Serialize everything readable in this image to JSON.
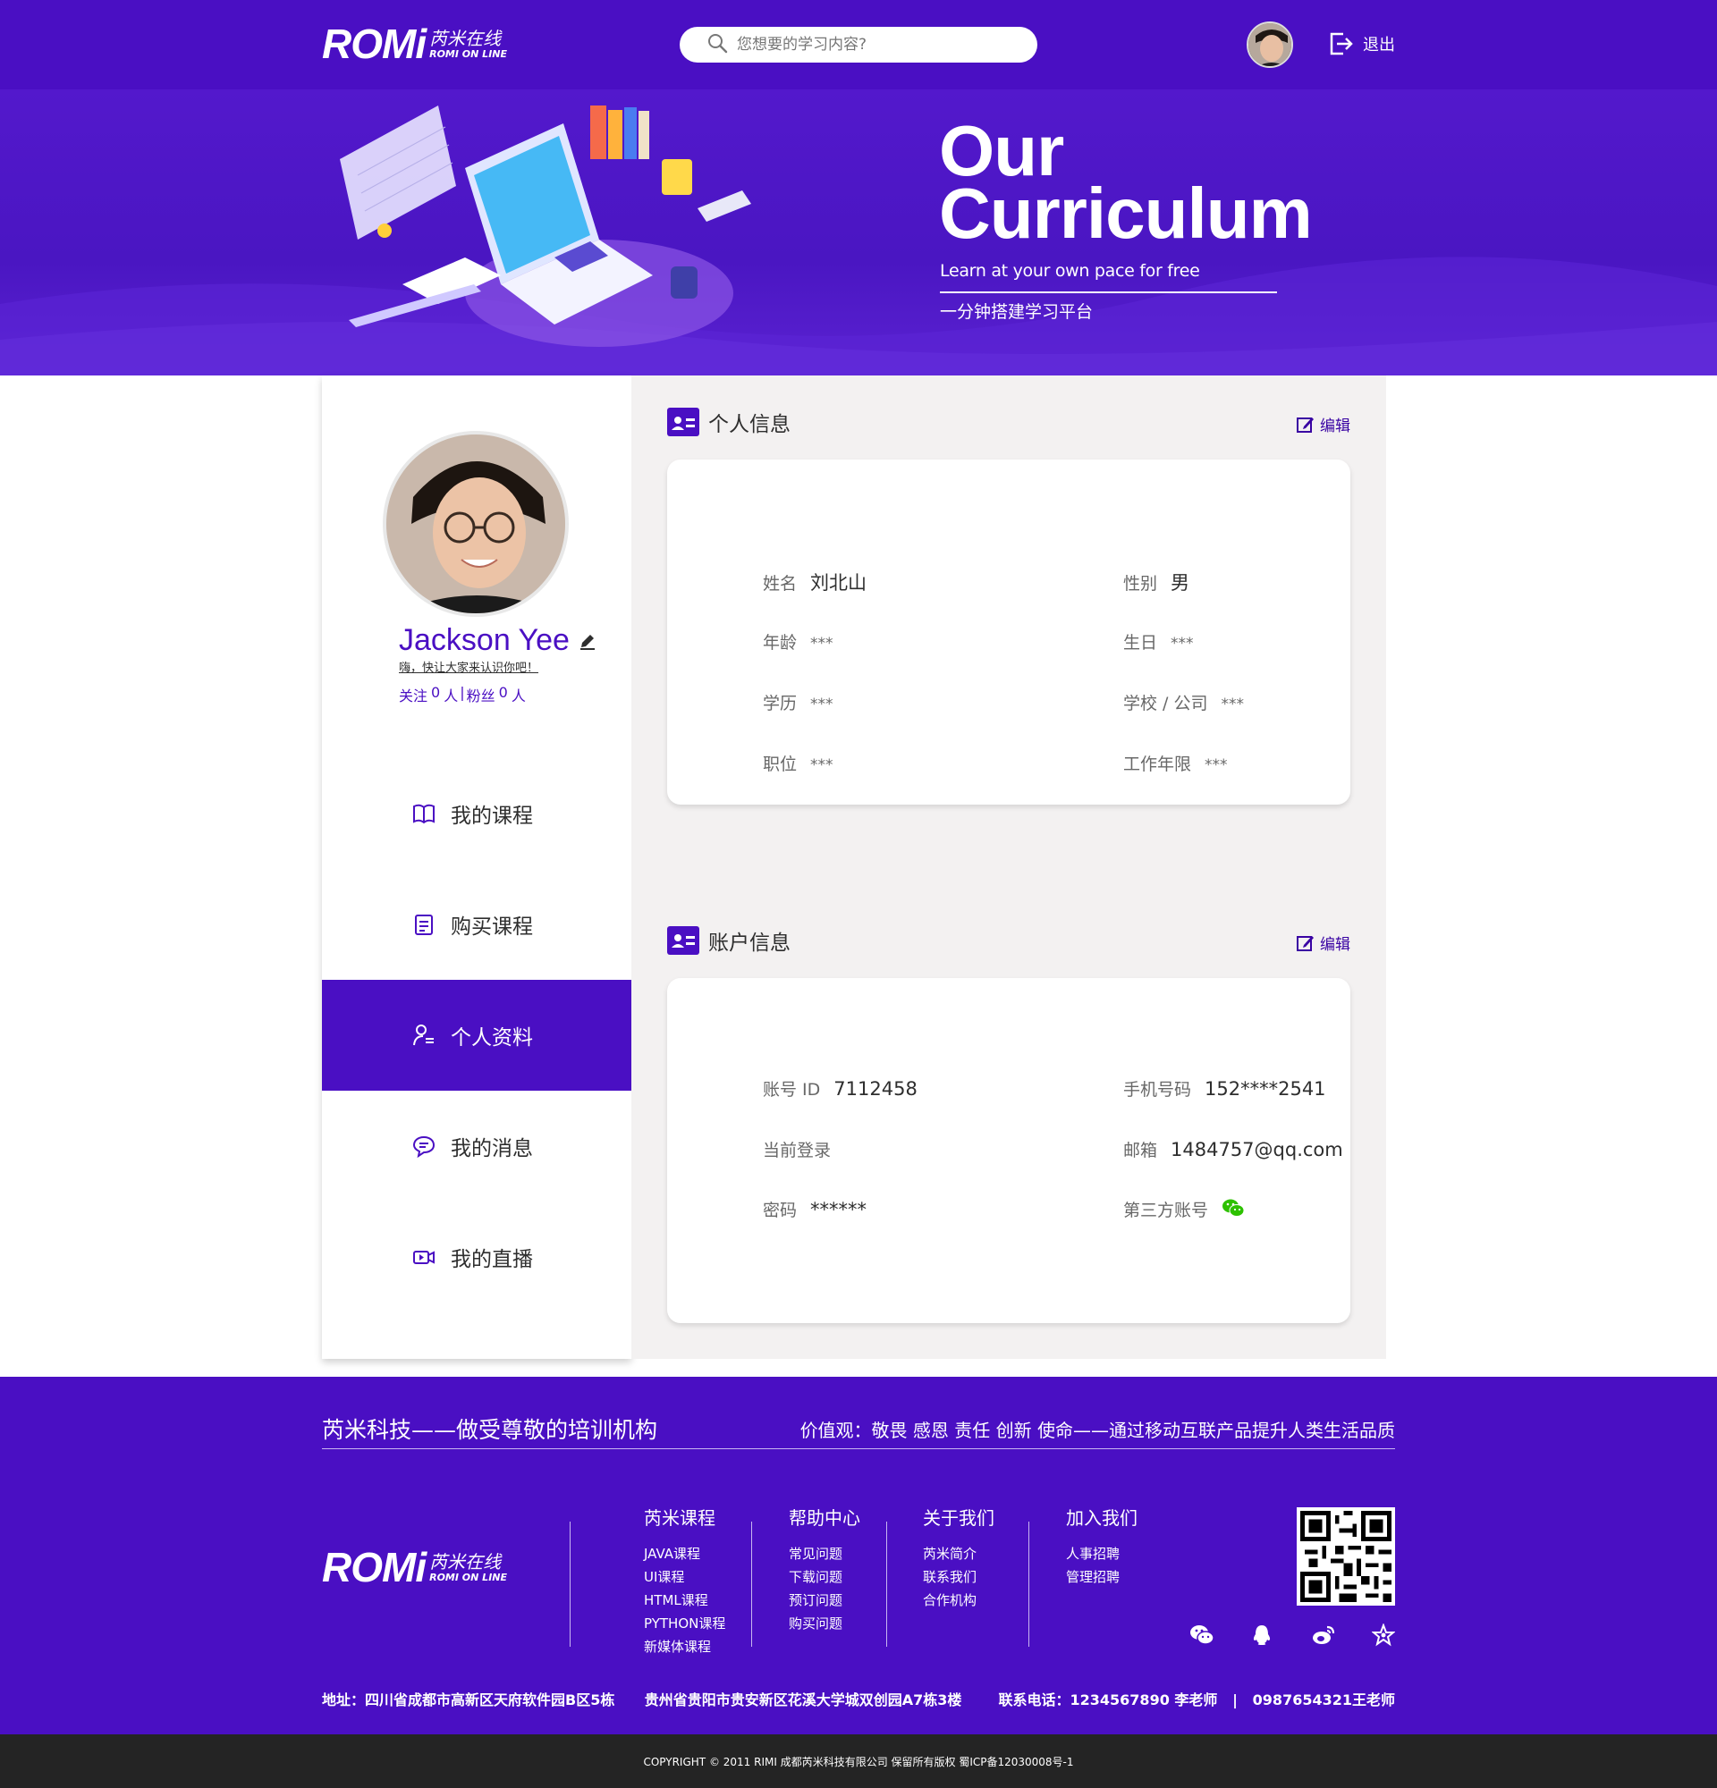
{
  "brand": {
    "logo_text": "ROMi",
    "logo_cn": "芮米在线",
    "logo_en": "ROMI ON LINE"
  },
  "header": {
    "search_placeholder": "您想要的学习内容?",
    "logout_label": "退出"
  },
  "banner": {
    "title_line1": "Our",
    "title_line2": "Curriculum",
    "subtitle": "Learn at your own pace for free",
    "tagline": "一分钟搭建学习平台"
  },
  "profile": {
    "name": "Jackson Yee",
    "bio": "嗨，快让大家来认识你吧！",
    "follow_label": "关注",
    "follow_count": "0",
    "fans_label": "粉丝",
    "fans_count": "0",
    "unit": "人"
  },
  "nav": {
    "items": [
      {
        "label": "我的课程",
        "icon": "book-icon"
      },
      {
        "label": "购买课程",
        "icon": "clipboard-icon"
      },
      {
        "label": "个人资料",
        "icon": "user-profile-icon",
        "active": true
      },
      {
        "label": "我的消息",
        "icon": "message-icon"
      },
      {
        "label": "我的直播",
        "icon": "video-icon"
      }
    ]
  },
  "personal_info": {
    "title": "个人信息",
    "edit_label": "编辑",
    "name_label": "姓名",
    "name_value": "刘北山",
    "gender_label": "性别",
    "gender_value": "男",
    "age_label": "年龄",
    "age_value": "***",
    "birthday_label": "生日",
    "birthday_value": "***",
    "education_label": "学历",
    "education_value": "***",
    "school_label": "学校 / 公司",
    "school_value": "***",
    "position_label": "职位",
    "position_value": "***",
    "years_label": "工作年限",
    "years_value": "***"
  },
  "account_info": {
    "title": "账户信息",
    "edit_label": "编辑",
    "account_id_label": "账号 ID",
    "account_id_value": "7112458",
    "phone_label": "手机号码",
    "phone_value": "152****2541",
    "login_label": "当前登录",
    "email_label": "邮箱",
    "email_value": "1484757@qq.com",
    "password_label": "密码",
    "password_value": "******",
    "third_party_label": "第三方账号"
  },
  "footer": {
    "slogan": "芮米科技——做受尊敬的培训机构",
    "values": "价值观：敬畏 感恩 责任 创新 使命——通过移动互联产品提升人类生活品质",
    "columns": [
      {
        "title": "芮米课程",
        "links": [
          "JAVA课程",
          "UI课程",
          "HTML课程",
          "PYTHON课程",
          "新媒体课程"
        ]
      },
      {
        "title": "帮助中心",
        "links": [
          "常见问题",
          "下载问题",
          "预订问题",
          "购买问题"
        ]
      },
      {
        "title": "关于我们",
        "links": [
          "芮米简介",
          "联系我们",
          "合作机构"
        ]
      },
      {
        "title": "加入我们",
        "links": [
          "人事招聘",
          "管理招聘"
        ]
      }
    ],
    "social_icons": [
      "wechat-icon",
      "qq-icon",
      "weibo-icon",
      "favorite-star-icon"
    ],
    "address": "地址：四川省成都市高新区天府软件园B区5栋      贵州省贵阳市贵安新区花溪大学城双创园A7栋3楼",
    "contact": "联系电话：1234567890 李老师   |   0987654321王老师",
    "copyright": "COPYRIGHT © 2011 RIMI 成都芮米科技有限公司 保留所有版权 蜀ICP备12030008号-1"
  },
  "colors": {
    "primary": "#4a0fc3",
    "link": "#3903a3",
    "text": "#2e2e2e",
    "label": "#686868",
    "panel_bg": "#f3f1f1",
    "card_bg": "#ffffff",
    "footer_bottom": "#242424"
  }
}
